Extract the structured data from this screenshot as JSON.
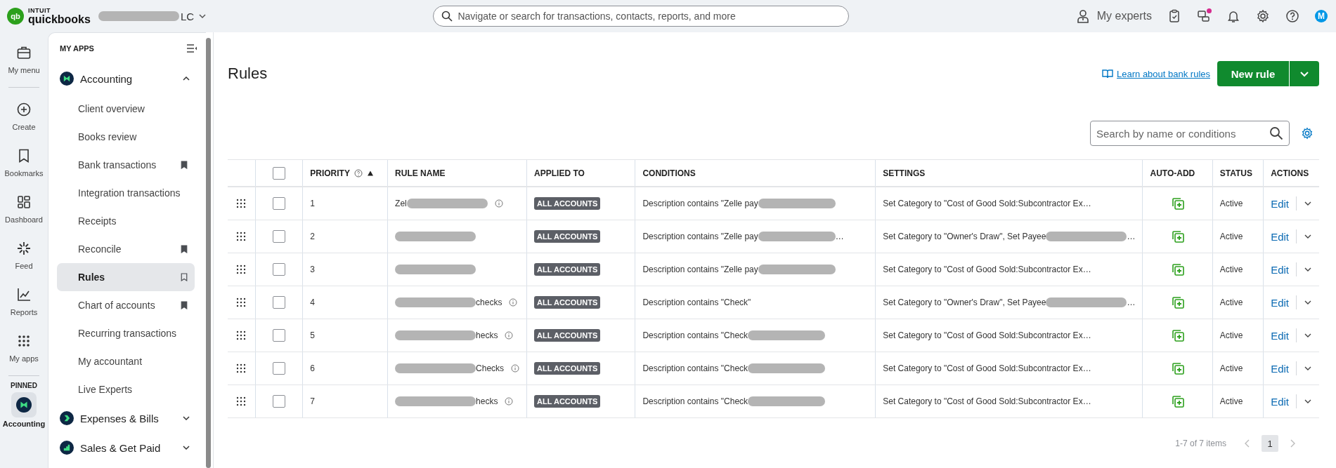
{
  "top_bar": {
    "logo": {
      "mark": "qb",
      "brand": "INTUIT",
      "product": "quickbooks"
    },
    "company": [
      {
        "kind": "redaction"
      },
      {
        "kind": "text",
        "text": "LC"
      }
    ],
    "search": {
      "placeholder": "Navigate or search for transactions, contacts, reports, and more"
    },
    "experts": "My experts",
    "notification_dot": true,
    "avatar": "M"
  },
  "rail": {
    "items": [
      {
        "label": "My menu",
        "selected": false
      },
      {
        "label": "Create",
        "selected": false
      },
      {
        "label": "Bookmarks",
        "selected": false
      },
      {
        "label": "Dashboard",
        "selected": false
      },
      {
        "label": "Feed",
        "selected": false
      },
      {
        "label": "Reports",
        "selected": false
      },
      {
        "label": "My apps",
        "selected": false
      }
    ],
    "pinned_label": "PINNED",
    "pinned": [
      {
        "label": "Accounting",
        "selected": true
      }
    ]
  },
  "sidebar": {
    "title": "MY APPS",
    "groups": [
      {
        "label": "Accounting",
        "expanded": true,
        "children": [
          {
            "label": "Client overview",
            "selected": false,
            "bookmarked": false
          },
          {
            "label": "Books review",
            "selected": false,
            "bookmarked": false
          },
          {
            "label": "Bank transactions",
            "selected": false,
            "bookmarked": true
          },
          {
            "label": "Integration transactions",
            "selected": false,
            "bookmarked": false
          },
          {
            "label": "Receipts",
            "selected": false,
            "bookmarked": false
          },
          {
            "label": "Reconcile",
            "selected": false,
            "bookmarked": true
          },
          {
            "label": "Rules",
            "selected": true,
            "bookmarked": false
          },
          {
            "label": "Chart of accounts",
            "selected": false,
            "bookmarked": true
          },
          {
            "label": "Recurring transactions",
            "selected": false,
            "bookmarked": false
          },
          {
            "label": "My accountant",
            "selected": false,
            "bookmarked": false
          },
          {
            "label": "Live Experts",
            "selected": false,
            "bookmarked": false
          }
        ]
      },
      {
        "label": "Expenses & Bills",
        "expanded": false
      },
      {
        "label": "Sales & Get Paid",
        "expanded": false
      }
    ]
  },
  "page": {
    "title": "Rules",
    "learn_link": "Learn about bank rules",
    "new_button": "New rule",
    "search": {
      "placeholder": "Search by name or conditions"
    }
  },
  "table": {
    "columns": [
      "PRIORITY",
      "RULE NAME",
      "APPLIED TO",
      "CONDITIONS",
      "SETTINGS",
      "AUTO-ADD",
      "STATUS",
      "ACTIONS"
    ],
    "header_checked": false,
    "rows": [
      {
        "checked": false,
        "priority": "1",
        "name": [
          {
            "kind": "text",
            "text": "Zel"
          },
          {
            "kind": "redaction"
          }
        ],
        "info": true,
        "applied_to": "ALL ACCOUNTS",
        "conditions": [
          {
            "kind": "text",
            "text": "Description contains \"Zelle pay"
          },
          {
            "kind": "redaction"
          }
        ],
        "settings": [
          {
            "kind": "text",
            "text": "Set Category to \"Cost of Good Sold:Subcontractor Ex…"
          }
        ],
        "auto_add": true,
        "status": "Active",
        "action": "Edit"
      },
      {
        "checked": false,
        "priority": "2",
        "name": [
          {
            "kind": "redaction"
          }
        ],
        "info": false,
        "applied_to": "ALL ACCOUNTS",
        "conditions": [
          {
            "kind": "text",
            "text": "Description contains \"Zelle pay"
          },
          {
            "kind": "redaction"
          },
          {
            "kind": "text",
            "text": "…"
          }
        ],
        "settings": [
          {
            "kind": "text",
            "text": "Set Category to \"Owner's Draw\", Set Payee"
          },
          {
            "kind": "redaction"
          },
          {
            "kind": "text",
            "text": "…"
          }
        ],
        "auto_add": true,
        "status": "Active",
        "action": "Edit"
      },
      {
        "checked": false,
        "priority": "3",
        "name": [
          {
            "kind": "redaction"
          }
        ],
        "info": false,
        "applied_to": "ALL ACCOUNTS",
        "conditions": [
          {
            "kind": "text",
            "text": "Description contains \"Zelle pay"
          },
          {
            "kind": "redaction"
          }
        ],
        "settings": [
          {
            "kind": "text",
            "text": "Set Category to \"Cost of Good Sold:Subcontractor Ex…"
          }
        ],
        "auto_add": true,
        "status": "Active",
        "action": "Edit"
      },
      {
        "checked": false,
        "priority": "4",
        "name": [
          {
            "kind": "redaction"
          },
          {
            "kind": "text",
            "text": "checks"
          }
        ],
        "info": true,
        "applied_to": "ALL ACCOUNTS",
        "conditions": [
          {
            "kind": "text",
            "text": "Description contains \"Check\""
          }
        ],
        "settings": [
          {
            "kind": "text",
            "text": "Set Category to \"Owner's Draw\", Set Payee"
          },
          {
            "kind": "redaction"
          },
          {
            "kind": "text",
            "text": "…"
          }
        ],
        "auto_add": true,
        "status": "Active",
        "action": "Edit"
      },
      {
        "checked": false,
        "priority": "5",
        "name": [
          {
            "kind": "redaction"
          },
          {
            "kind": "text",
            "text": "hecks"
          }
        ],
        "info": true,
        "applied_to": "ALL ACCOUNTS",
        "conditions": [
          {
            "kind": "text",
            "text": "Description contains \"Check"
          },
          {
            "kind": "redaction"
          }
        ],
        "settings": [
          {
            "kind": "text",
            "text": "Set Category to \"Cost of Good Sold:Subcontractor Ex…"
          }
        ],
        "auto_add": true,
        "status": "Active",
        "action": "Edit"
      },
      {
        "checked": false,
        "priority": "6",
        "name": [
          {
            "kind": "redaction"
          },
          {
            "kind": "text",
            "text": "Checks"
          }
        ],
        "info": true,
        "applied_to": "ALL ACCOUNTS",
        "conditions": [
          {
            "kind": "text",
            "text": "Description contains \"Check"
          },
          {
            "kind": "redaction"
          }
        ],
        "settings": [
          {
            "kind": "text",
            "text": "Set Category to \"Cost of Good Sold:Subcontractor Ex…"
          }
        ],
        "auto_add": true,
        "status": "Active",
        "action": "Edit"
      },
      {
        "checked": false,
        "priority": "7",
        "name": [
          {
            "kind": "redaction"
          },
          {
            "kind": "text",
            "text": "hecks"
          }
        ],
        "info": true,
        "applied_to": "ALL ACCOUNTS",
        "conditions": [
          {
            "kind": "text",
            "text": "Description contains \"Check"
          },
          {
            "kind": "redaction"
          }
        ],
        "settings": [
          {
            "kind": "text",
            "text": "Set Category to \"Cost of Good Sold:Subcontractor Ex…"
          }
        ],
        "auto_add": true,
        "status": "Active",
        "action": "Edit"
      }
    ]
  },
  "pagination": {
    "summary": "1-7 of 7 items",
    "pages": [
      {
        "label": "1",
        "selected": true
      }
    ]
  }
}
